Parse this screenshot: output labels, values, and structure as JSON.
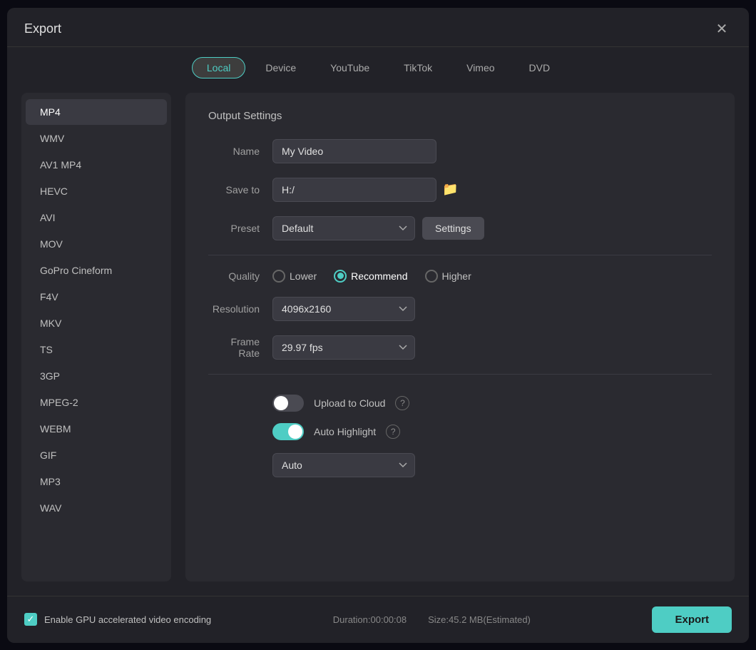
{
  "dialog": {
    "title": "Export",
    "close_label": "✕"
  },
  "tabs": {
    "items": [
      {
        "id": "local",
        "label": "Local",
        "active": true
      },
      {
        "id": "device",
        "label": "Device",
        "active": false
      },
      {
        "id": "youtube",
        "label": "YouTube",
        "active": false
      },
      {
        "id": "tiktok",
        "label": "TikTok",
        "active": false
      },
      {
        "id": "vimeo",
        "label": "Vimeo",
        "active": false
      },
      {
        "id": "dvd",
        "label": "DVD",
        "active": false
      }
    ]
  },
  "formats": [
    {
      "id": "mp4",
      "label": "MP4",
      "active": true
    },
    {
      "id": "wmv",
      "label": "WMV",
      "active": false
    },
    {
      "id": "av1mp4",
      "label": "AV1 MP4",
      "active": false
    },
    {
      "id": "hevc",
      "label": "HEVC",
      "active": false
    },
    {
      "id": "avi",
      "label": "AVI",
      "active": false
    },
    {
      "id": "mov",
      "label": "MOV",
      "active": false
    },
    {
      "id": "goprocineform",
      "label": "GoPro Cineform",
      "active": false
    },
    {
      "id": "f4v",
      "label": "F4V",
      "active": false
    },
    {
      "id": "mkv",
      "label": "MKV",
      "active": false
    },
    {
      "id": "ts",
      "label": "TS",
      "active": false
    },
    {
      "id": "3gp",
      "label": "3GP",
      "active": false
    },
    {
      "id": "mpeg2",
      "label": "MPEG-2",
      "active": false
    },
    {
      "id": "webm",
      "label": "WEBM",
      "active": false
    },
    {
      "id": "gif",
      "label": "GIF",
      "active": false
    },
    {
      "id": "mp3",
      "label": "MP3",
      "active": false
    },
    {
      "id": "wav",
      "label": "WAV",
      "active": false
    }
  ],
  "output": {
    "section_title": "Output Settings",
    "name_label": "Name",
    "name_value": "My Video",
    "name_placeholder": "My Video",
    "save_to_label": "Save to",
    "save_to_value": "H:/",
    "preset_label": "Preset",
    "preset_value": "Default",
    "settings_button": "Settings",
    "quality_label": "Quality",
    "quality_options": [
      {
        "id": "lower",
        "label": "Lower",
        "checked": false
      },
      {
        "id": "recommend",
        "label": "Recommend",
        "checked": true
      },
      {
        "id": "higher",
        "label": "Higher",
        "checked": false
      }
    ],
    "resolution_label": "Resolution",
    "resolution_value": "4096x2160",
    "frame_rate_label": "Frame Rate",
    "frame_rate_value": "29.97 fps",
    "upload_to_cloud_label": "Upload to Cloud",
    "upload_to_cloud_on": false,
    "auto_highlight_label": "Auto Highlight",
    "auto_highlight_on": true,
    "auto_highlight_dropdown": "Auto"
  },
  "footer": {
    "gpu_label": "Enable GPU accelerated video encoding",
    "duration_label": "Duration:00:00:08",
    "size_label": "Size:45.2 MB(Estimated)",
    "export_button": "Export"
  },
  "icons": {
    "folder": "🗁",
    "chevron_down": "▾",
    "help": "?",
    "check": "✓"
  }
}
